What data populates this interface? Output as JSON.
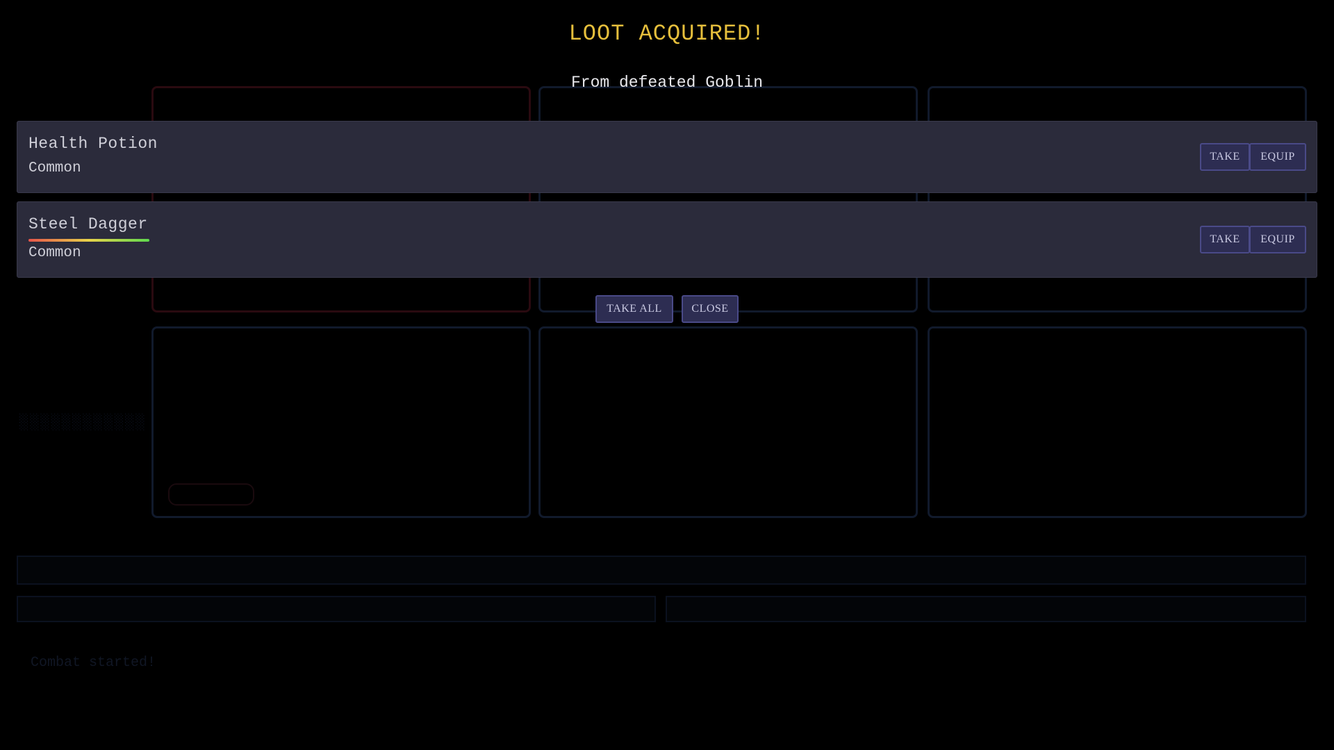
{
  "modal": {
    "title": "LOOT ACQUIRED!",
    "subtitle": "From defeated Goblin",
    "items": [
      {
        "name": "Health Potion",
        "rarity": "Common",
        "take_label": "TAKE",
        "equip_label": "EQUIP"
      },
      {
        "name": "Steel Dagger",
        "rarity": "Common",
        "take_label": "TAKE",
        "equip_label": "EQUIP",
        "durability": 1.0
      }
    ],
    "take_all_label": "TAKE ALL",
    "close_label": "CLOSE"
  },
  "background": {
    "log_text": "Combat started!"
  },
  "colors": {
    "title": "#e6bf3c",
    "item_card": "#2b2b3b",
    "button": "#2d2d52",
    "button_border": "#4a4a88"
  }
}
